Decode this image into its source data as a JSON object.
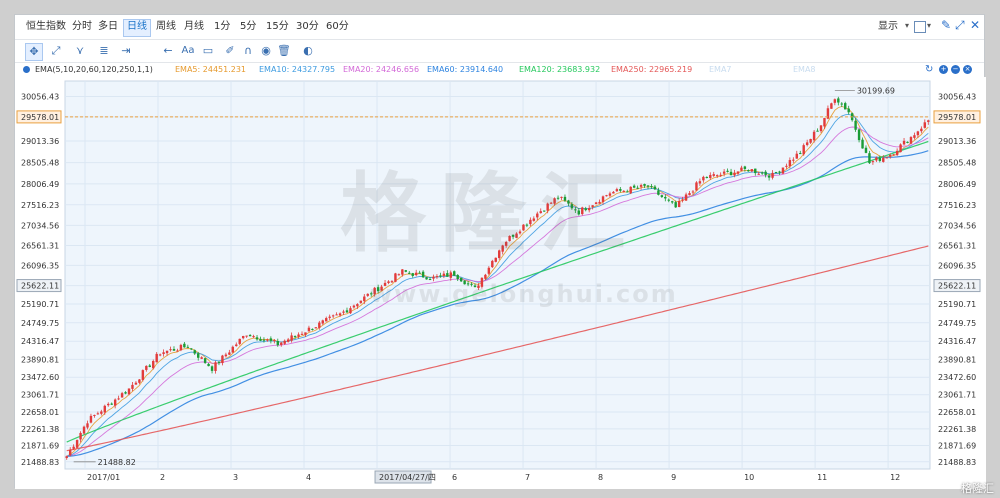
{
  "tabs": [
    "恒生指数",
    "分时",
    "多日",
    "日线",
    "周线",
    "月线",
    "1分",
    "5分",
    "15分",
    "30分",
    "60分"
  ],
  "active_tab": 3,
  "display_label": "显示",
  "toolbar": {
    "text_button": "Aa",
    "icons": [
      "crosshair-icon",
      "line-tool-icon",
      "polyline-tool-icon",
      "fib-tool-icon",
      "measure-tool-icon",
      "back-arrow-icon",
      "text-tool-icon",
      "comment-icon",
      "pen-icon",
      "magnet-icon",
      "eye-icon",
      "trash-icon",
      "toggle-icon"
    ]
  },
  "ema_header": {
    "title": "EMA(5,10,20,60,120,250,1,1)",
    "items": [
      {
        "label": "EMA5: 24451.231",
        "color": "#e69a2e"
      },
      {
        "label": "EMA10: 24327.795",
        "color": "#3d9be0"
      },
      {
        "label": "EMA20: 24246.656",
        "color": "#d36ad8"
      },
      {
        "label": "EMA60: 23914.640",
        "color": "#2f84e0"
      },
      {
        "label": "EMA120: 23683.932",
        "color": "#26c95e"
      },
      {
        "label": "EMA250: 22965.219",
        "color": "#e45858"
      },
      {
        "label": "EMA7",
        "color": "#c8dcef"
      },
      {
        "label": "EMA8",
        "color": "#c8dcef"
      }
    ]
  },
  "watermark": {
    "main": "格隆汇",
    "sub": "www.gelonghui.com"
  },
  "corner_logo": "格隆汇",
  "chart_data": {
    "type": "candlestick",
    "y_ticks": [
      "30056.43",
      "29578.01",
      "29013.36",
      "28505.48",
      "28006.49",
      "27516.23",
      "27034.56",
      "26561.31",
      "26096.35",
      "25622.11",
      "25190.71",
      "24749.75",
      "24316.47",
      "23890.81",
      "23472.60",
      "23061.71",
      "22658.01",
      "22261.38",
      "21871.69",
      "21488.83"
    ],
    "ylim": [
      21320,
      30420
    ],
    "x_labels": [
      "2017/01",
      "2",
      "3",
      "4",
      "2017/04/27/四",
      "6",
      "7",
      "8",
      "9",
      "10",
      "11",
      "12"
    ],
    "highlighted_x_label": "2017/04/27/四",
    "current_price": "29578.01",
    "crosshair_price": "25622.11",
    "annotations": {
      "high": "30199.69",
      "low": "21488.82"
    },
    "price_anchors": [
      [
        0,
        21620
      ],
      [
        6,
        22450
      ],
      [
        18,
        23200
      ],
      [
        27,
        24050
      ],
      [
        35,
        24200
      ],
      [
        42,
        23680
      ],
      [
        52,
        24500
      ],
      [
        61,
        24250
      ],
      [
        70,
        24600
      ],
      [
        79,
        24950
      ],
      [
        88,
        25450
      ],
      [
        97,
        25950
      ],
      [
        106,
        25800
      ],
      [
        112,
        25900
      ],
      [
        118,
        25540
      ],
      [
        126,
        26600
      ],
      [
        135,
        27250
      ],
      [
        142,
        27700
      ],
      [
        148,
        27350
      ],
      [
        157,
        27800
      ],
      [
        168,
        27950
      ],
      [
        176,
        27450
      ],
      [
        184,
        28150
      ],
      [
        197,
        28350
      ],
      [
        204,
        28200
      ],
      [
        212,
        28750
      ],
      [
        218,
        29400
      ],
      [
        222,
        30050
      ],
      [
        226,
        29700
      ],
      [
        232,
        28500
      ],
      [
        238,
        28700
      ],
      [
        244,
        29100
      ],
      [
        250,
        29578
      ]
    ],
    "series": [
      {
        "name": "EMA5",
        "color": "#e69a2e"
      },
      {
        "name": "EMA10",
        "color": "#3d9be0"
      },
      {
        "name": "EMA20",
        "color": "#d36ad8"
      },
      {
        "name": "EMA60",
        "color": "#2f84e0"
      },
      {
        "name": "EMA120",
        "color": "#26c95e"
      },
      {
        "name": "EMA250",
        "color": "#e45858"
      }
    ],
    "ema120_path": [
      [
        21950,
        0
      ],
      [
        29000,
        250
      ]
    ],
    "ema250_path": [
      [
        21750,
        0
      ],
      [
        26550,
        250
      ]
    ],
    "colors": {
      "up": "#e23b3b",
      "down": "#1a9c36",
      "grid": "#dbe7f3",
      "plot_bg": "#eef5fc"
    }
  }
}
